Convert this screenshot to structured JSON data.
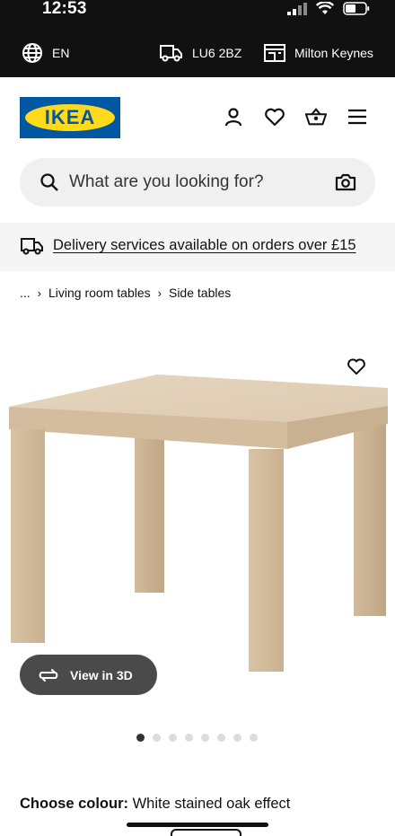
{
  "status_bar": {
    "time": "12:53"
  },
  "top_bar": {
    "language": "EN",
    "postcode": "LU6 2BZ",
    "store": "Milton Keynes"
  },
  "header": {
    "logo_text": "IKEA",
    "icons": [
      "person-icon",
      "heart-icon",
      "basket-icon",
      "menu-icon"
    ]
  },
  "search": {
    "placeholder": "What are you looking for?"
  },
  "banner": {
    "text": "Delivery services available on orders over £15"
  },
  "breadcrumb": {
    "ellipsis": "...",
    "items": [
      "Living room tables",
      "Side tables"
    ]
  },
  "product": {
    "view_3d_label": "View in 3D",
    "image_count": 8,
    "active_image": 1,
    "colour_label": "Choose colour:",
    "colour_value": "White stained oak effect"
  },
  "colors": {
    "brand_blue": "#0058A3",
    "brand_yellow": "#FFDA1A",
    "dark": "#111111"
  }
}
